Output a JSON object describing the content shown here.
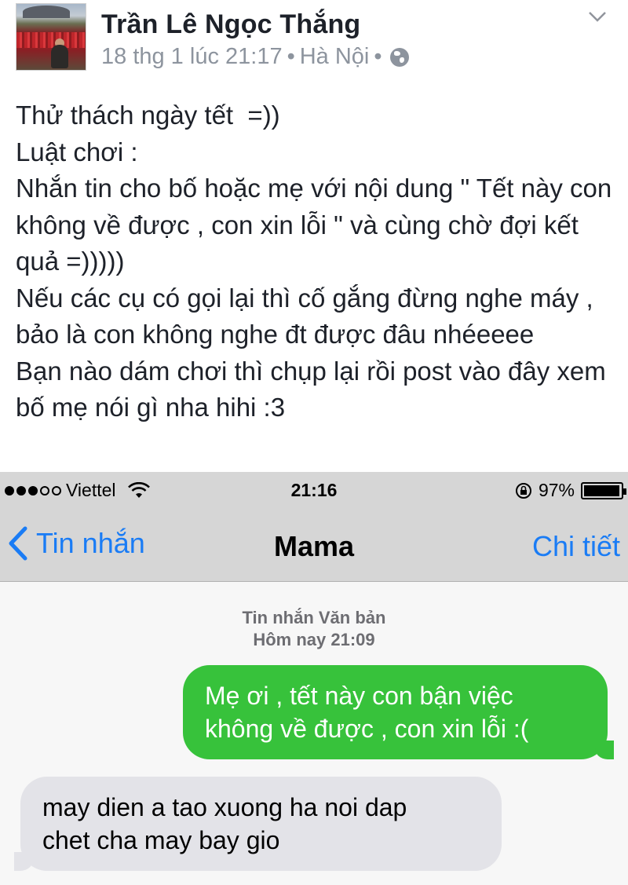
{
  "post": {
    "author": "Trần Lê Ngọc Thắng",
    "timestamp": "18 thg 1 lúc 21:17",
    "separator": "•",
    "location": "Hà Nội",
    "privacy_icon": "globe-icon",
    "menu_icon": "chevron-down-icon",
    "body_lines": [
      "Thử thách ngày tết  =))",
      "Luật chơi :",
      "Nhắn tin cho bố hoặc mẹ với nội dung \" Tết này con không về được , con xin lỗi \" và cùng chờ đợi kết quả =)))))",
      "Nếu các cụ có gọi lại thì cố gắng đừng nghe máy , bảo là con không nghe đt được đâu nhéeeee",
      "Bạn nào dám chơi thì chụp lại rồi post vào đây xem bố mẹ nói gì nha hihi :3"
    ]
  },
  "phone": {
    "status_bar": {
      "carrier": "Viettel",
      "signal_bars_filled": 3,
      "signal_bars_total": 5,
      "time": "21:16",
      "battery_percent": "97%",
      "battery_level": 0.97
    },
    "nav": {
      "back_label": "Tin nhắn",
      "title": "Mama",
      "details_label": "Chi tiết"
    },
    "thread": {
      "type_label": "Tin nhắn Văn bản",
      "date_label": "Hôm nay 21:09"
    },
    "messages": [
      {
        "direction": "sent",
        "text": "Mẹ ơi , tết này con bận việc\nkhông về được , con xin lỗi :("
      },
      {
        "direction": "received",
        "text": "may dien a tao xuong ha noi dap\nchet cha may bay gio"
      }
    ],
    "colors": {
      "ios_blue": "#1a7cf5",
      "sms_green": "#37c23b",
      "received_gray": "#e3e3e8",
      "bar_gray": "#d6d6d6"
    }
  }
}
